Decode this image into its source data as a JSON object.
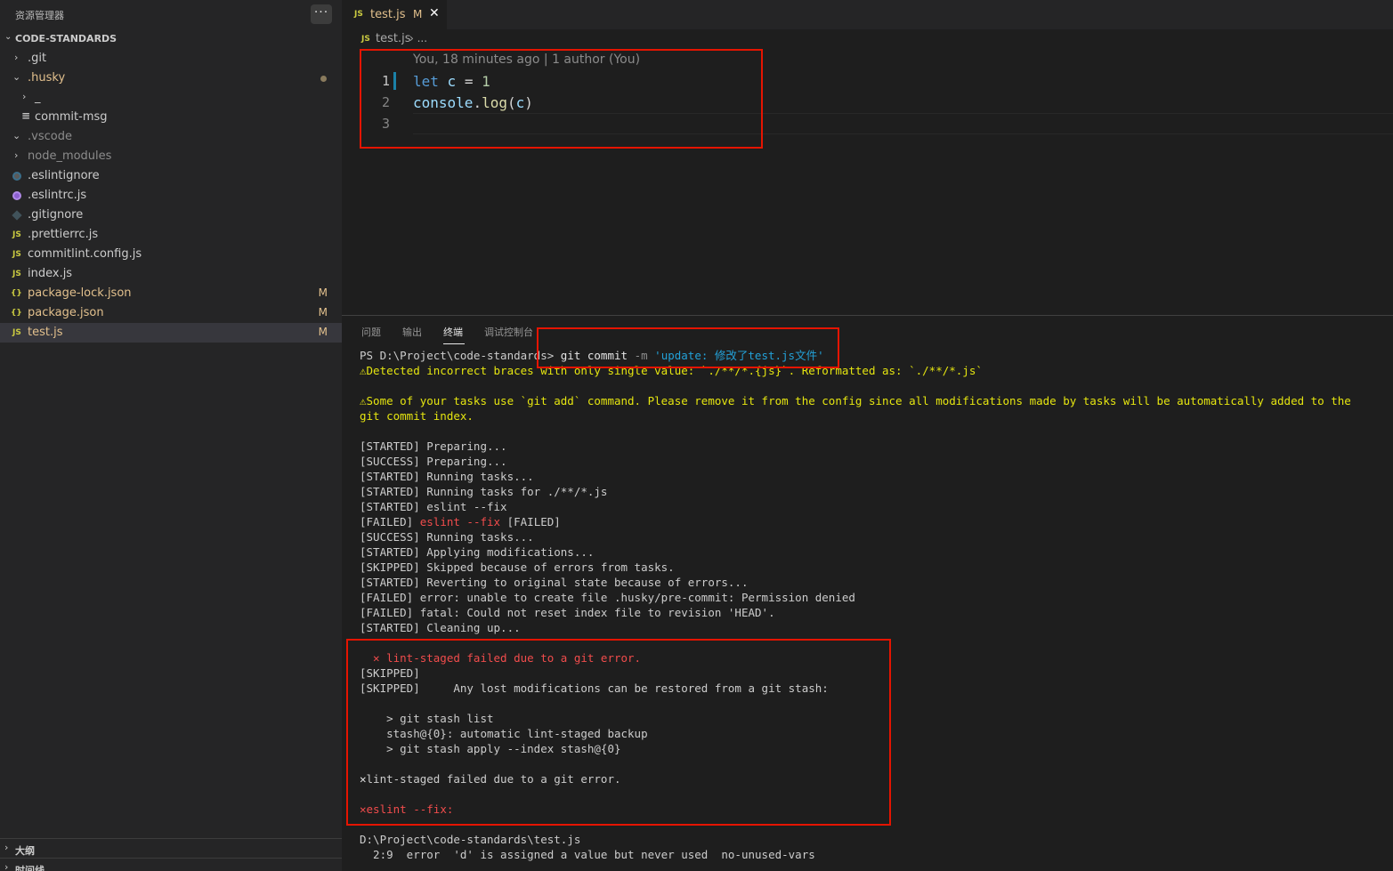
{
  "sidebar": {
    "title": "资源管理器",
    "more_label": "···",
    "root_label": "CODE-STANDARDS",
    "items": [
      {
        "label": ".git",
        "badge": ""
      },
      {
        "label": ".husky",
        "badge": ""
      },
      {
        "label": "_",
        "badge": ""
      },
      {
        "label": "commit-msg",
        "badge": ""
      },
      {
        "label": ".vscode",
        "badge": ""
      },
      {
        "label": "node_modules",
        "badge": ""
      },
      {
        "label": ".eslintignore",
        "badge": ""
      },
      {
        "label": ".eslintrc.js",
        "badge": ""
      },
      {
        "label": ".gitignore",
        "badge": ""
      },
      {
        "label": ".prettierrc.js",
        "badge": ""
      },
      {
        "label": "commitlint.config.js",
        "badge": ""
      },
      {
        "label": "index.js",
        "badge": ""
      },
      {
        "label": "package-lock.json",
        "badge": "M"
      },
      {
        "label": "package.json",
        "badge": "M"
      },
      {
        "label": "test.js",
        "badge": "M"
      }
    ],
    "outline_label": "大纲",
    "timeline_label": "时间线"
  },
  "icons": {
    "js": "JS",
    "json": "{}",
    "lines": "≡",
    "chevron_right": "›",
    "chevron_down": "⌄"
  },
  "colors": {
    "accent_box": "#e51400",
    "modified": "#e2c08d",
    "js_icon": "#cbcb41"
  },
  "editor": {
    "tab_label": "test.js",
    "tab_modified": "M",
    "tab_close": "✕",
    "breadcrumb_file": "test.js",
    "breadcrumb_rest": "› ...",
    "blame": "You, 18 minutes ago | 1 author (You)",
    "line_numbers": [
      "1",
      "2",
      "3"
    ],
    "code": {
      "l1_kw": "let",
      "l1_var": "c",
      "l1_op": "=",
      "l1_num": "1",
      "l2_obj": "console",
      "l2_dot": ".",
      "l2_fn": "log",
      "l2_open": "(",
      "l2_arg": "c",
      "l2_close": ")"
    }
  },
  "panel": {
    "tabs": [
      "问题",
      "输出",
      "终端",
      "调试控制台"
    ],
    "active_tab": "终端"
  },
  "terminal": {
    "prompt": "PS D:\\Project\\code-standards>",
    "cmd_git": "git commit",
    "cmd_flag": "-m",
    "cmd_msg": "'update: 修改了test.js文件'",
    "lines": [
      {
        "text": "⚠Detected incorrect braces with only single value: `./**/*.{js}`. Reformatted as: `./**/*.js`",
        "style": "yellow"
      },
      {
        "text": "⚠Some of your tasks use `git add` command. Please remove it from the config since all modifications made by tasks will be automatically added to the",
        "style": "yellow"
      },
      {
        "text": "git commit index.",
        "style": "yellow"
      },
      {
        "text": "[STARTED] Preparing...",
        "style": "normal"
      },
      {
        "text": "[SUCCESS] Preparing...",
        "style": "normal"
      },
      {
        "text": "[STARTED] Running tasks...",
        "style": "normal"
      },
      {
        "text": "[STARTED] Running tasks for ./**/*.js",
        "style": "normal"
      },
      {
        "text": "[STARTED] eslint --fix",
        "style": "normal"
      },
      {
        "text": "[FAILED]",
        "style": "normal"
      },
      {
        "text": "eslint --fix",
        "style": "red"
      },
      {
        "text": "[FAILED]",
        "style": "normal"
      },
      {
        "text": "[SUCCESS] Running tasks...",
        "style": "normal"
      },
      {
        "text": "[STARTED] Applying modifications...",
        "style": "normal"
      },
      {
        "text": "[SKIPPED] Skipped because of errors from tasks.",
        "style": "normal"
      },
      {
        "text": "[STARTED] Reverting to original state because of errors...",
        "style": "normal"
      },
      {
        "text": "[FAILED] error: unable to create file .husky/pre-commit: Permission denied",
        "style": "normal"
      },
      {
        "text": "[FAILED] fatal: Could not reset index file to revision 'HEAD'.",
        "style": "normal"
      },
      {
        "text": "[STARTED] Cleaning up...",
        "style": "normal"
      },
      {
        "text": "  ✕ lint-staged failed due to a git error.",
        "style": "red"
      },
      {
        "text": "[SKIPPED]",
        "style": "normal"
      },
      {
        "text": "[SKIPPED]     Any lost modifications can be restored from a git stash:",
        "style": "normal"
      },
      {
        "text": "    > git stash list",
        "style": "normal"
      },
      {
        "text": "    stash@{0}: automatic lint-staged backup",
        "style": "normal"
      },
      {
        "text": "    > git stash apply --index stash@{0}",
        "style": "normal"
      },
      {
        "text": "✕",
        "style": "white"
      },
      {
        "text": "lint-staged failed due to a git error.",
        "style": "normal"
      },
      {
        "text": "✕",
        "style": "red"
      },
      {
        "text": "eslint --fix:",
        "style": "red"
      },
      {
        "text": "D:\\Project\\code-standards\\test.js",
        "style": "normal"
      },
      {
        "text": "  2:9  error  'd' is assigned a value but never used  no-unused-vars",
        "style": "normal"
      }
    ]
  }
}
